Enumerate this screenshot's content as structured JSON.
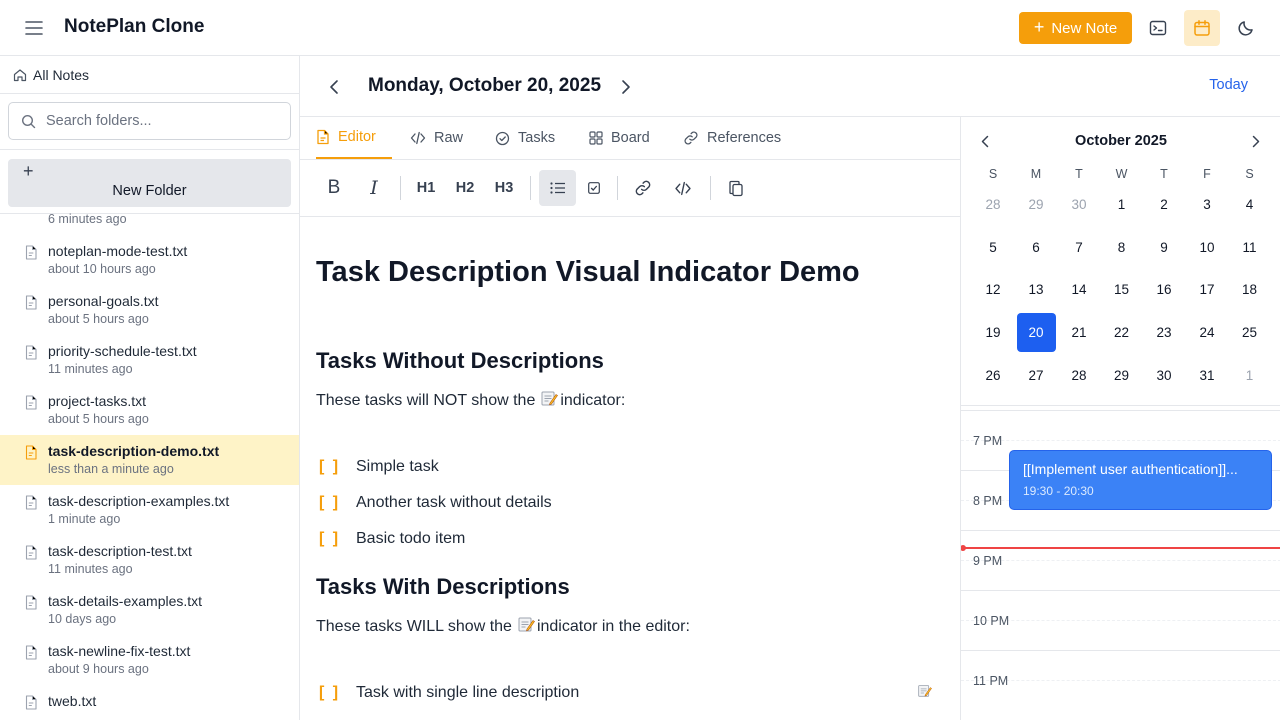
{
  "app": {
    "title": "NotePlan Clone"
  },
  "topbar": {
    "new_note_label": "New Note"
  },
  "sidebar": {
    "all_notes_label": "All Notes",
    "search_placeholder": "Search folders...",
    "new_folder_label": "New Folder",
    "partial_top_time": "6 minutes ago",
    "files": [
      {
        "name": "noteplan-mode-test.txt",
        "time": "about 10 hours ago"
      },
      {
        "name": "personal-goals.txt",
        "time": "about 5 hours ago"
      },
      {
        "name": "priority-schedule-test.txt",
        "time": "11 minutes ago"
      },
      {
        "name": "project-tasks.txt",
        "time": "about 5 hours ago"
      },
      {
        "name": "task-description-demo.txt",
        "time": "less than a minute ago",
        "active": true
      },
      {
        "name": "task-description-examples.txt",
        "time": "1 minute ago"
      },
      {
        "name": "task-description-test.txt",
        "time": "11 minutes ago"
      },
      {
        "name": "task-details-examples.txt",
        "time": "10 days ago"
      },
      {
        "name": "task-newline-fix-test.txt",
        "time": "about 9 hours ago"
      },
      {
        "name": "tweb.txt",
        "time": ""
      }
    ]
  },
  "header": {
    "date_title": "Monday, October 20, 2025",
    "today_label": "Today"
  },
  "tabs": [
    {
      "label": "Editor",
      "icon": "file-icon"
    },
    {
      "label": "Raw",
      "icon": "code-icon"
    },
    {
      "label": "Tasks",
      "icon": "check-circle-icon"
    },
    {
      "label": "Board",
      "icon": "grid-icon"
    },
    {
      "label": "References",
      "icon": "link-icon"
    }
  ],
  "toolbar": {
    "b": "B",
    "i": "I",
    "h1": "H1",
    "h2": "H2",
    "h3": "H3"
  },
  "editor": {
    "title": "Task Description Visual Indicator Demo",
    "section1_heading": "Tasks Without Descriptions",
    "section1_text_before": "These tasks will NOT show the",
    "section1_text_after": "indicator:",
    "tasks1": [
      "Simple task",
      "Another task without details",
      "Basic todo item"
    ],
    "section2_heading": "Tasks With Descriptions",
    "section2_text_before": "These tasks WILL show the",
    "section2_text_after": "indicator in the editor:",
    "tasks2": [
      "Task with single line description"
    ],
    "checkbox": "[ ]"
  },
  "calendar": {
    "month_title": "October 2025",
    "weekdays": [
      "S",
      "M",
      "T",
      "W",
      "T",
      "F",
      "S"
    ],
    "weeks": [
      [
        "28",
        "29",
        "30",
        "1",
        "2",
        "3",
        "4"
      ],
      [
        "5",
        "6",
        "7",
        "8",
        "9",
        "10",
        "11"
      ],
      [
        "12",
        "13",
        "14",
        "15",
        "16",
        "17",
        "18"
      ],
      [
        "19",
        "20",
        "21",
        "22",
        "23",
        "24",
        "25"
      ],
      [
        "26",
        "27",
        "28",
        "29",
        "30",
        "31",
        "1"
      ]
    ],
    "selected_day": "20",
    "hours": [
      "7 PM",
      "8 PM",
      "9 PM",
      "10 PM",
      "11 PM"
    ],
    "event": {
      "title": "[[Implement user authentication]]...",
      "time": "19:30 - 20:30"
    }
  },
  "colors": {
    "accent": "#f59e0b",
    "selected": "#1d5ff0",
    "event": "#3b82f6",
    "now": "#ef4444"
  }
}
